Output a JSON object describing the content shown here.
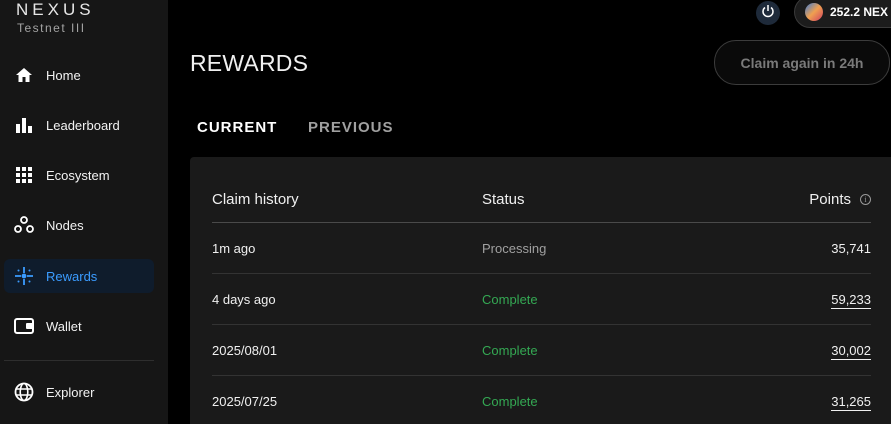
{
  "brand": {
    "name": "NEXUS",
    "subtitle": "Testnet III"
  },
  "sidebar": {
    "items": [
      {
        "label": "Home",
        "icon": "home-icon"
      },
      {
        "label": "Leaderboard",
        "icon": "bar-chart-icon"
      },
      {
        "label": "Ecosystem",
        "icon": "grid-icon"
      },
      {
        "label": "Nodes",
        "icon": "nodes-icon"
      },
      {
        "label": "Rewards",
        "icon": "rewards-sparkle-icon",
        "active": true
      },
      {
        "label": "Wallet",
        "icon": "wallet-icon"
      },
      {
        "label": "Explorer",
        "icon": "globe-icon"
      }
    ]
  },
  "header": {
    "balance": "252.2 NEX",
    "power_icon": "power-icon"
  },
  "page": {
    "title": "REWARDS",
    "claim_button": "Claim again in 24h",
    "tabs": [
      "CURRENT",
      "PREVIOUS"
    ]
  },
  "table": {
    "columns": [
      "Claim history",
      "Status",
      "Points"
    ],
    "rows": [
      {
        "claim": "1m ago",
        "status": "Processing",
        "points": "35,741"
      },
      {
        "claim": "4 days ago",
        "status": "Complete",
        "points": "59,233"
      },
      {
        "claim": "2025/08/01",
        "status": "Complete",
        "points": "30,002"
      },
      {
        "claim": "2025/07/25",
        "status": "Complete",
        "points": "31,265"
      }
    ]
  },
  "colors": {
    "accent": "#3b9cff",
    "processing": "#a0a0a0",
    "complete": "#34a853"
  }
}
